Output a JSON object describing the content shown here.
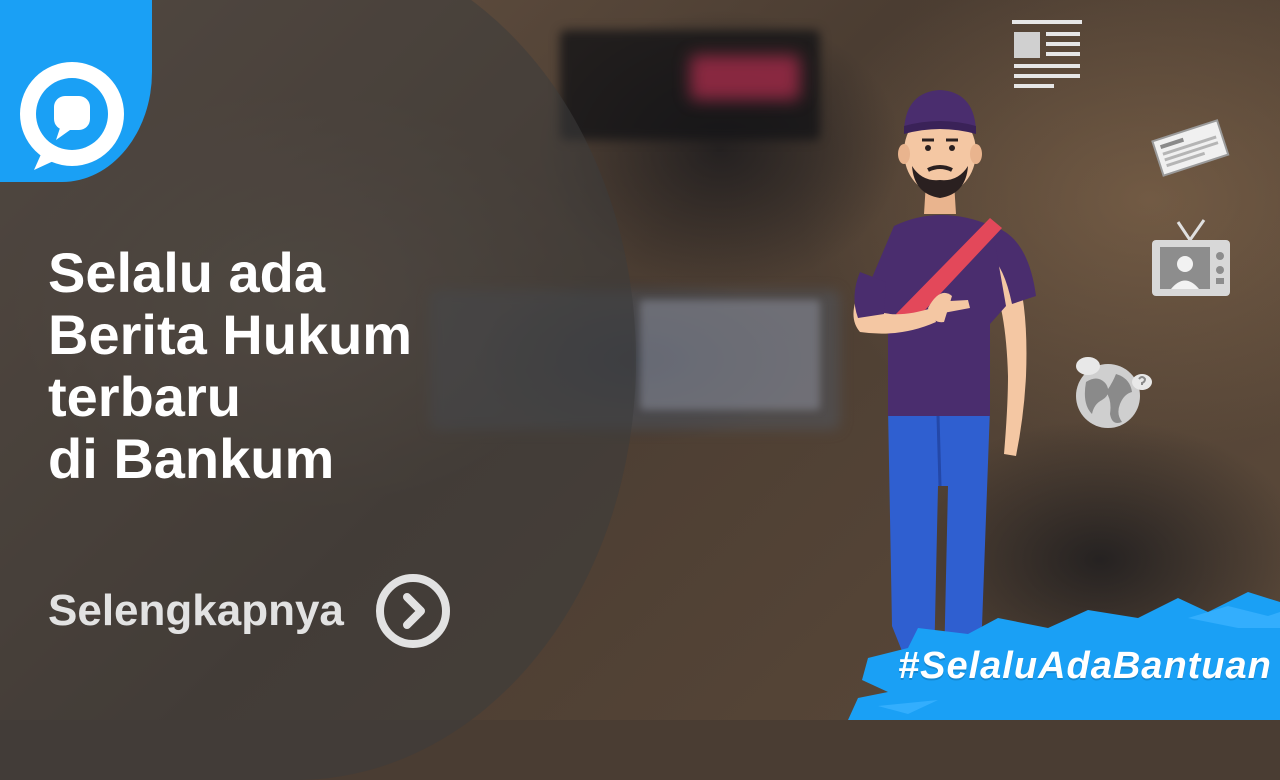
{
  "headline": {
    "lines": [
      "Selalu ada",
      "Berita Hukum",
      "terbaru",
      "di Bankum"
    ]
  },
  "cta": {
    "label": "Selengkapnya",
    "icon": "chevron-right-circle-icon"
  },
  "hashtag": "#SelaluAdaBantuan",
  "icons": {
    "logo": "chat-bubble-logo-icon",
    "article": "article-icon",
    "newspaper": "newspaper-icon",
    "tv": "tv-icon",
    "globe": "globe-icon"
  },
  "colors": {
    "brand_blue": "#1aa0f5",
    "headline_text": "#ffffff",
    "cta_text": "#e2e2e2"
  }
}
